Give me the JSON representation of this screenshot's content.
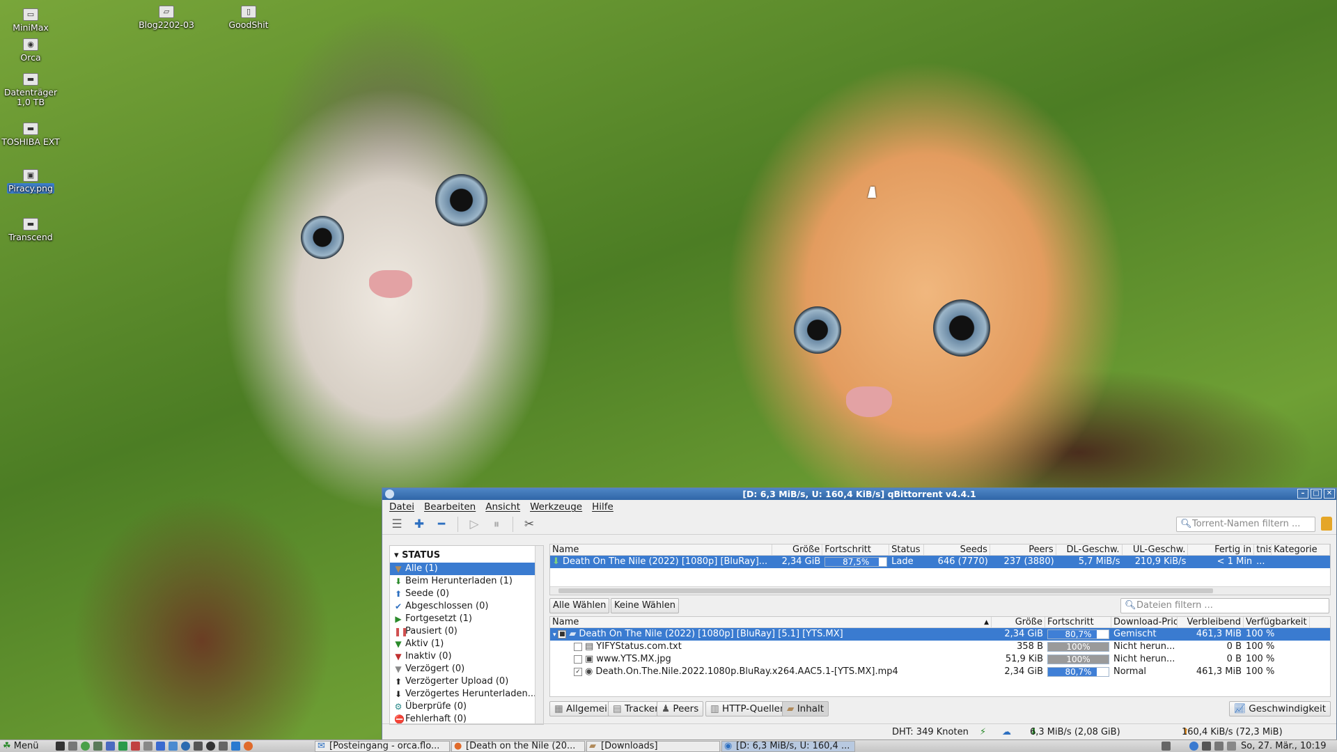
{
  "desktop": {
    "icons": [
      {
        "label": "MiniMax",
        "icon": "computer-icon"
      },
      {
        "label": "Orca",
        "icon": "camera-icon"
      },
      {
        "label": "Datenträger 1,0 TB",
        "icon": "drive-icon"
      },
      {
        "label": "TOSHIBA EXT",
        "icon": "drive-icon"
      },
      {
        "label": "Piracy.png",
        "icon": "image-file-icon"
      },
      {
        "label": "Transcend",
        "icon": "drive-icon"
      },
      {
        "label": "Blog2202-03",
        "icon": "folder-icon"
      },
      {
        "label": "GoodShit",
        "icon": "file-icon"
      }
    ]
  },
  "window": {
    "title": "[D: 6,3 MiB/s, U: 160,4 KiB/s] qBittorrent v4.4.1",
    "menu": [
      "Datei",
      "Bearbeiten",
      "Ansicht",
      "Werkzeuge",
      "Hilfe"
    ],
    "toolbar_icons": [
      "rss-icon",
      "add-icon",
      "remove-icon",
      "play-icon",
      "pause-icon",
      "settings-icon"
    ],
    "torrent_filter_placeholder": "Torrent-Namen filtern ...",
    "sidebar": {
      "header": "STATUS",
      "items": [
        {
          "label": "Alle (1)",
          "icon": "filter-icon",
          "color": "#b08a5a"
        },
        {
          "label": "Beim Herunterladen (1)",
          "icon": "download-arrow-icon",
          "color": "#2a8a2a"
        },
        {
          "label": "Seede (0)",
          "icon": "upload-arrow-icon",
          "color": "#2d6fc0"
        },
        {
          "label": "Abgeschlossen (0)",
          "icon": "checkmark-icon",
          "color": "#2d6fc0"
        },
        {
          "label": "Fortgesetzt (1)",
          "icon": "play-icon",
          "color": "#2a8a2a"
        },
        {
          "label": "Pausiert (0)",
          "icon": "pause-icon",
          "color": "#d05050"
        },
        {
          "label": "Aktiv (1)",
          "icon": "filter-icon",
          "color": "#2a8a2a"
        },
        {
          "label": "Inaktiv (0)",
          "icon": "filter-icon",
          "color": "#c03030"
        },
        {
          "label": "Verzögert (0)",
          "icon": "filter-icon",
          "color": "#888888"
        },
        {
          "label": "Verzögerter Upload (0)",
          "icon": "upload-arrow-icon",
          "color": "#222222"
        },
        {
          "label": "Verzögertes Herunterladen...",
          "icon": "download-arrow-icon",
          "color": "#222222"
        },
        {
          "label": "Überprüfe (0)",
          "icon": "gear-icon",
          "color": "#2a8a8a"
        },
        {
          "label": "Fehlerhaft (0)",
          "icon": "error-icon",
          "color": "#d02020"
        }
      ]
    },
    "torrent_table": {
      "headers": [
        "Name",
        "Größe",
        "Fortschritt",
        "Status",
        "Seeds",
        "Peers",
        "DL-Geschw.",
        "UL-Geschw.",
        "Fertig in",
        "tnis",
        "Kategorie"
      ],
      "rows": [
        {
          "name": "Death On The Nile (2022) [1080p] [BluRay]...",
          "size": "2,34 GiB",
          "progress_text": "87,5%",
          "progress": 0.875,
          "status": "Lade",
          "seeds": "646 (7770)",
          "peers": "237 (3880)",
          "dl": "5,7 MiB/s",
          "ul": "210,9 KiB/s",
          "eta": "< 1 Min",
          "ratio": "...",
          "category": ""
        }
      ]
    },
    "select_all": "Alle Wählen",
    "select_none": "Keine Wählen",
    "file_filter_placeholder": "Dateien filtern ...",
    "file_table": {
      "headers": [
        "Name",
        "Größe",
        "Fortschritt",
        "Download-Prio",
        "Verbleibend",
        "Verfügbarkeit"
      ],
      "rows": [
        {
          "name": "Death On The Nile (2022) [1080p] [BluRay] [5.1] [YTS.MX]",
          "size": "2,34 GiB",
          "progress_text": "80,7%",
          "progress": 0.807,
          "prio": "Gemischt",
          "remaining": "461,3 MiB",
          "avail": "100 %",
          "level": 0,
          "type": "folder",
          "checked": "partial"
        },
        {
          "name": "YIFYStatus.com.txt",
          "size": "358 B",
          "progress_text": "100%",
          "progress": 1.0,
          "prio": "Nicht herun...",
          "remaining": "0 B",
          "avail": "100 %",
          "level": 1,
          "type": "text",
          "checked": "no"
        },
        {
          "name": "www.YTS.MX.jpg",
          "size": "51,9 KiB",
          "progress_text": "100%",
          "progress": 1.0,
          "prio": "Nicht herun...",
          "remaining": "0 B",
          "avail": "100 %",
          "level": 1,
          "type": "image",
          "checked": "no"
        },
        {
          "name": "Death.On.The.Nile.2022.1080p.BluRay.x264.AAC5.1-[YTS.MX].mp4",
          "size": "2,34 GiB",
          "progress_text": "80,7%",
          "progress": 0.807,
          "prio": "Normal",
          "remaining": "461,3 MiB",
          "avail": "100 %",
          "level": 1,
          "type": "video",
          "checked": "yes"
        }
      ]
    },
    "tabs": [
      "Allgemein",
      "Tracker",
      "Peers",
      "HTTP-Quellen",
      "Inhalt"
    ],
    "active_tab": "Inhalt",
    "speed_button": "Geschwindigkeit",
    "statusbar": {
      "dht": "DHT: 349 Knoten",
      "download": "6,3 MiB/s (2,08 GiB)",
      "upload": "160,4 KiB/s (72,3 MiB)"
    }
  },
  "taskbar": {
    "menu_label": "Menü",
    "tasks": [
      {
        "label": "[Posteingang - orca.flo...",
        "icon": "mail-icon",
        "active": false
      },
      {
        "label": "[Death on the Nile (20...",
        "icon": "browser-icon",
        "active": false
      },
      {
        "label": "[Downloads]",
        "icon": "folder-icon",
        "active": false
      },
      {
        "label": "[D: 6,3 MiB/s, U: 160,4 ...",
        "icon": "qbittorrent-icon",
        "active": true
      }
    ],
    "clock": "So, 27. Mär., 10:19"
  }
}
